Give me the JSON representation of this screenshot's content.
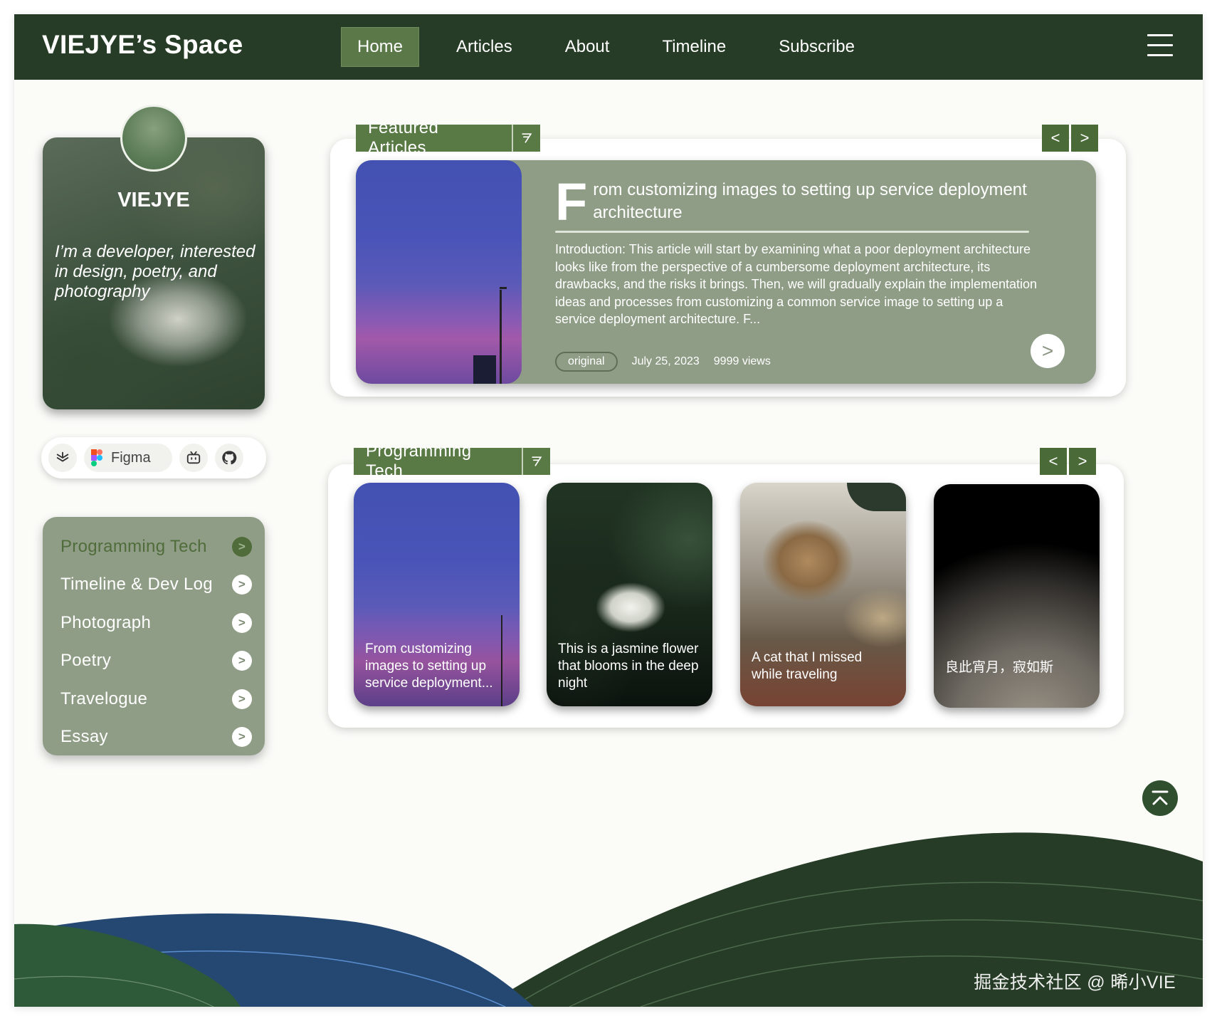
{
  "brand": "VIEJYE’s Space",
  "nav": {
    "items": [
      "Home",
      "Articles",
      "About",
      "Timeline",
      "Subscribe"
    ],
    "active": "Home"
  },
  "profile": {
    "name": "VIEJYE",
    "bio": "I’m a developer, interested in design, poetry, and photography"
  },
  "social": {
    "figma_label": "Figma"
  },
  "categories": [
    {
      "label": "Programming Tech",
      "active": true
    },
    {
      "label": "Timeline & Dev Log",
      "active": false
    },
    {
      "label": "Photograph",
      "active": false
    },
    {
      "label": "Poetry",
      "active": false
    },
    {
      "label": "Travelogue",
      "active": false
    },
    {
      "label": "Essay",
      "active": false
    }
  ],
  "featured": {
    "section_title": "Featured Articles",
    "prev": "<",
    "next": ">",
    "title_initial": "F",
    "title_rest": "rom customizing images to setting up service deployment architecture",
    "excerpt": "Introduction: This article will start by examining what a poor deployment architecture looks like from the perspective of a cumbersome deployment architecture, its drawbacks, and the risks it brings. Then, we will gradually explain the implementation ideas and processes from customizing a common service image to setting up a service deployment architecture. F...",
    "tag": "original",
    "date": "July 25, 2023",
    "views": "9999 views",
    "go": ">"
  },
  "programming": {
    "section_title": "Programming Tech",
    "prev": "<",
    "next": ">",
    "tiles": [
      {
        "caption": "From customizing images to setting up service deployment..."
      },
      {
        "caption": "This is a jasmine flower that blooms in the deep night"
      },
      {
        "caption": "A cat that I missed while traveling"
      },
      {
        "caption": "良此宵月，寂如斯"
      }
    ]
  },
  "watermark": "掘金技术社区 @ 晞小VIE",
  "colors": {
    "nav_bg": "#263c26",
    "accent": "#5a7a45",
    "card_bg": "#8f9d86",
    "wave_dark": "#263c26",
    "wave_blue": "#244872",
    "wave_green": "#2e5a3a"
  }
}
